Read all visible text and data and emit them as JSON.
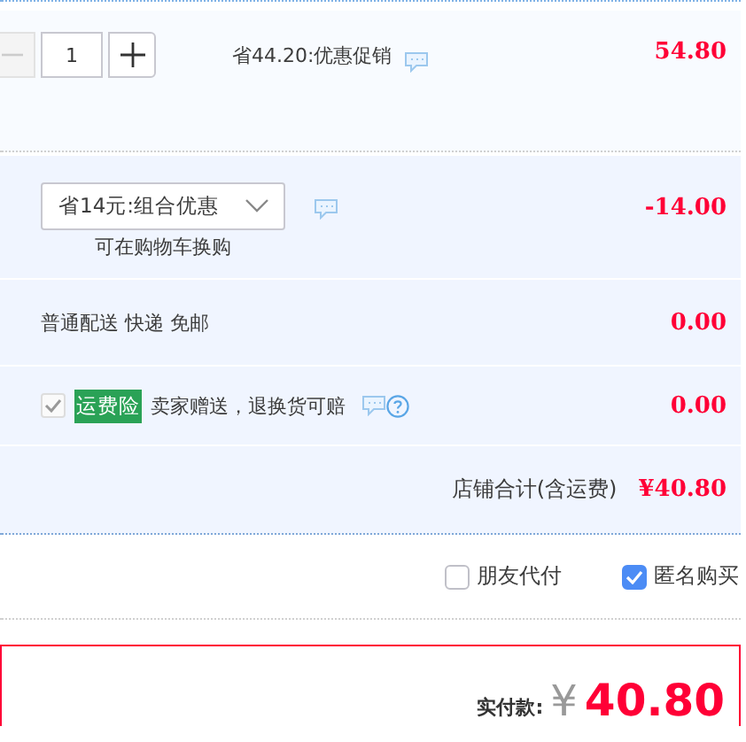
{
  "item": {
    "quantity": "1",
    "decrease_disabled": true,
    "promo": "省44.20:优惠促销",
    "price": "54.80"
  },
  "combo": {
    "selected_option": "省14元:组合优惠",
    "note": "可在购物车换购",
    "amount": "-14.00"
  },
  "shipping": {
    "label": "普通配送 快递 免邮",
    "amount": "0.00"
  },
  "insurance": {
    "checked": true,
    "disabled": true,
    "badge": "运费险",
    "text": "卖家赠送，退换货可赔",
    "amount": "0.00"
  },
  "store_total": {
    "label": "店铺合计(含运费)",
    "amount": "¥40.80"
  },
  "options": [
    {
      "label": "朋友代付",
      "checked": false
    },
    {
      "label": "匿名购买",
      "checked": true
    }
  ],
  "payment": {
    "label": "实付款:",
    "currency": "¥",
    "amount": "40.80"
  }
}
